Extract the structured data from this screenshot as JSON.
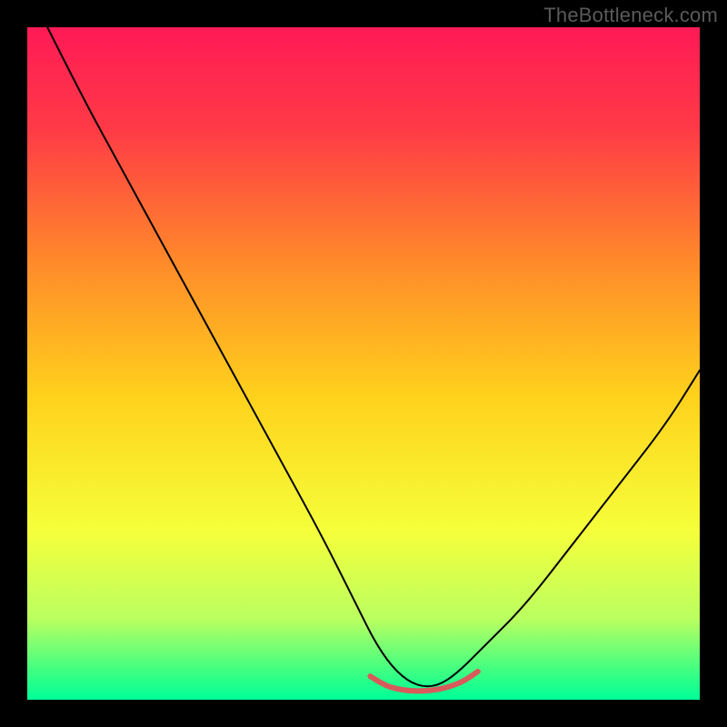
{
  "watermark": "TheBottleneck.com",
  "chart_data": {
    "type": "line",
    "title": "",
    "xlabel": "",
    "ylabel": "",
    "xlim": [
      0,
      100
    ],
    "ylim": [
      0,
      100
    ],
    "background_gradient": {
      "type": "vertical",
      "stops": [
        {
          "position": 0.0,
          "color": "#ff1a56"
        },
        {
          "position": 0.15,
          "color": "#ff3a46"
        },
        {
          "position": 0.35,
          "color": "#ff8a2a"
        },
        {
          "position": 0.55,
          "color": "#ffd21c"
        },
        {
          "position": 0.75,
          "color": "#f5ff3a"
        },
        {
          "position": 0.88,
          "color": "#baff60"
        },
        {
          "position": 0.97,
          "color": "#2aff88"
        },
        {
          "position": 1.0,
          "color": "#00ff99"
        }
      ]
    },
    "series": [
      {
        "name": "curve",
        "color": "#000000",
        "width": 2,
        "x": [
          3,
          8,
          14,
          20,
          26,
          32,
          38,
          44,
          49,
          52,
          55,
          58,
          61,
          64,
          68,
          74,
          81,
          88,
          95,
          100
        ],
        "y": [
          100,
          90,
          79,
          68,
          57,
          46,
          35,
          24,
          14,
          8,
          4,
          2,
          2,
          4,
          8,
          14,
          23,
          32,
          41,
          49
        ]
      },
      {
        "name": "bottom-bump",
        "color": "#d85a5a",
        "width": 6,
        "x": [
          51,
          53,
          55,
          57,
          59,
          61,
          63,
          65,
          67
        ],
        "y": [
          3.5,
          2.2,
          1.6,
          1.3,
          1.3,
          1.5,
          2.0,
          2.8,
          4.2
        ]
      }
    ]
  }
}
